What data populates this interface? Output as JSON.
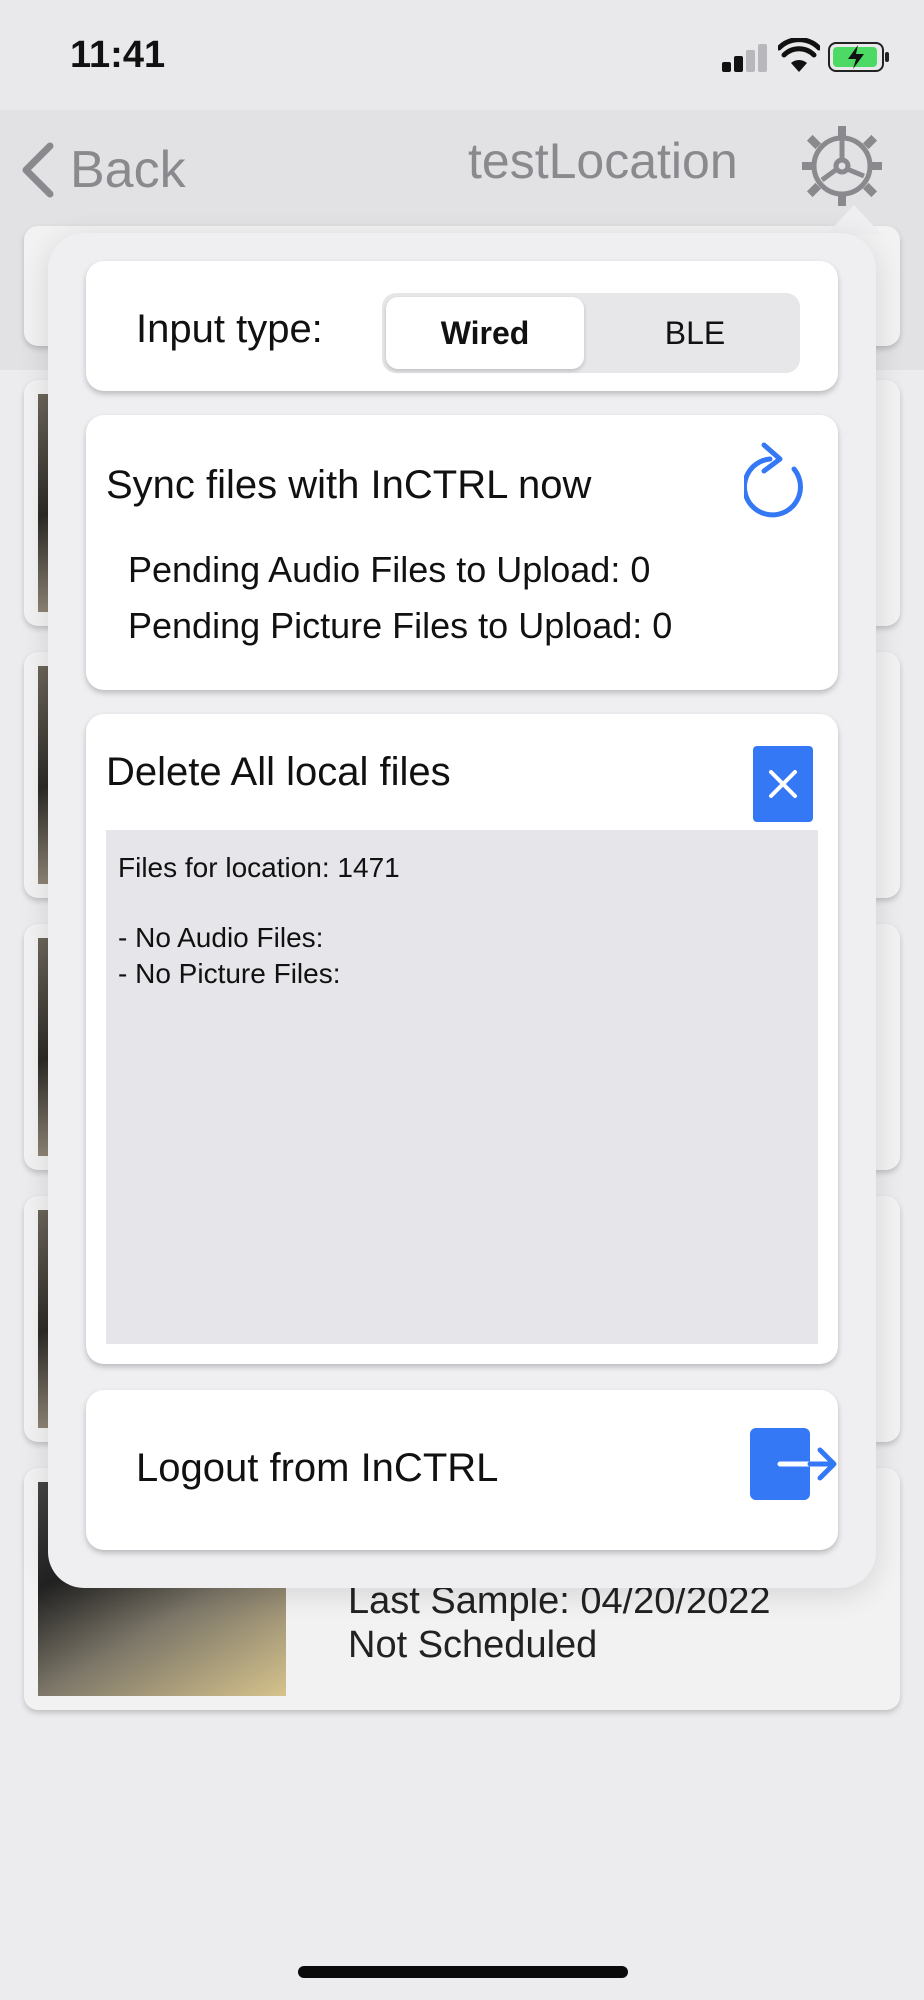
{
  "status_bar": {
    "time": "11:41"
  },
  "nav": {
    "back_label": "Back",
    "title": "testLocation"
  },
  "background_card": {
    "last_sample": "Last Sample: 04/20/2022",
    "schedule": "Not Scheduled"
  },
  "settings": {
    "input_type": {
      "label": "Input type:",
      "options": [
        "Wired",
        "BLE"
      ],
      "selected": "Wired"
    },
    "sync": {
      "title": "Sync files with InCTRL now",
      "pending_audio": "Pending Audio Files to Upload: 0",
      "pending_pictures": "Pending Picture Files to Upload: 0"
    },
    "delete": {
      "title": "Delete All local files",
      "files_location": "Files for location: 1471",
      "no_audio": "- No Audio Files:",
      "no_pictures": "- No Picture Files:"
    },
    "logout": {
      "label": "Logout from InCTRL"
    }
  },
  "colors": {
    "accent": "#3478f6",
    "popover_bg": "#efeff2",
    "files_box_bg": "#e5e5ea"
  },
  "icons": [
    "back-chevron-icon",
    "gear-icon",
    "sync-icon",
    "close-icon",
    "logout-icon"
  ]
}
